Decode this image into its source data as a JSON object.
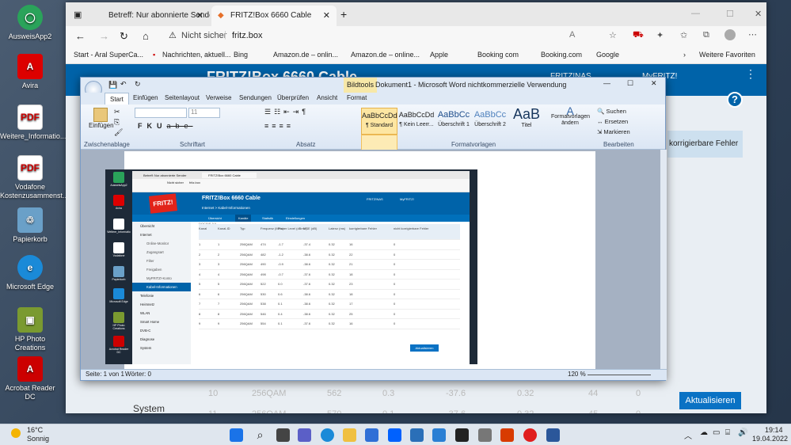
{
  "desktop": {
    "icons": [
      {
        "label": "AusweisApp2",
        "color": "#2aa35a"
      },
      {
        "label": "Avira",
        "color": "#d00"
      },
      {
        "label": "Weitere_Informatio...",
        "color": "#c00"
      },
      {
        "label": "Vodafone Kostenzusammenst...",
        "color": "#c00"
      },
      {
        "label": "Papierkorb",
        "color": "#6aa0c8"
      },
      {
        "label": "Microsoft Edge",
        "color": "#1a8ad8"
      },
      {
        "label": "HP Photo Creations",
        "color": "#7a9a30"
      },
      {
        "label": "Acrobat Reader DC",
        "color": "#c00"
      }
    ]
  },
  "browser": {
    "tabs": [
      {
        "title": "Betreff: Nur abonnierte Sender m"
      },
      {
        "title": "FRITZ!Box 6660 Cable"
      }
    ],
    "security": "Nicht sicher",
    "url": "fritz.box",
    "favorites": [
      "Start - Aral SuperCa...",
      "Nachrichten, aktuell...",
      "Bing",
      "Amazon.de – onlin...",
      "Amazon.de – online...",
      "Apple",
      "Booking com",
      "Booking.com",
      "Google"
    ],
    "more_favorites": "Weitere Favoriten",
    "page": {
      "title": "FRITZ!Box 6660 Cable",
      "nav1": "FRITZ!NAS",
      "nav2": "MyFRITZ!",
      "col_header": "korrigierbare Fehler",
      "sidebar_bottom": "System",
      "button": "Aktualisieren",
      "bg_rows": [
        [
          "10",
          "256QAM",
          "562",
          "0.3",
          "-37.6",
          "0.32",
          "44",
          "0"
        ],
        [
          "11",
          "256QAM",
          "570",
          "0.1",
          "-37.6",
          "0.32",
          "45",
          "0"
        ]
      ]
    }
  },
  "word": {
    "context_tab": "Bildtools",
    "title": "Dokument1 - Microsoft Word nichtkommerzielle Verwendung",
    "tabs": [
      "Start",
      "Einfügen",
      "Seitenlayout",
      "Verweise",
      "Sendungen",
      "Überprüfen",
      "Ansicht",
      "Format"
    ],
    "groups": [
      "Zwischenablage",
      "Schriftart",
      "Absatz",
      "Formatvorlagen",
      "Bearbeiten"
    ],
    "paste": "Einfügen",
    "font_size": "11",
    "styles": [
      {
        "preview": "AaBbCcDd",
        "name": "¶ Standard"
      },
      {
        "preview": "AaBbCcDd",
        "name": "¶ Kein Leerr..."
      },
      {
        "preview": "AaBbCc",
        "name": "Überschrift 1"
      },
      {
        "preview": "AaBbCc",
        "name": "Überschrift 2"
      },
      {
        "preview": "AaB",
        "name": "Titel"
      }
    ],
    "change_styles": "Formatvorlagen ändern",
    "edit": [
      "Suchen",
      "Ersetzen",
      "Markieren"
    ],
    "status": {
      "page": "Seite: 1 von 1",
      "words": "Wörter: 0",
      "zoom": "120 %"
    }
  },
  "inner": {
    "tabs": [
      "Betreff: Nur abonnierte Sender",
      "FRITZ!Box 6660 Cable"
    ],
    "security": "Nicht sicher",
    "url": "fritz.box",
    "title": "FRITZ!Box 6660 Cable",
    "breadcrumb": "Internet > Kabel-Informationen",
    "nav": [
      "FRITZ!NAS",
      "MyFRITZ!"
    ],
    "subtabs": [
      "Übersicht",
      "Kanäle",
      "Statistik",
      "Einstellungen"
    ],
    "docsis": "DOCSIS 3.0",
    "sidebar": [
      "Übersicht",
      "Internet",
      "Online-Monitor",
      "Zugangsart",
      "Filter",
      "Freigaben",
      "MyFRITZ!-Konto",
      "Kabel-Informationen",
      "Telefonie",
      "Heimnetz",
      "WLAN",
      "Smart Home",
      "DVB-C",
      "Diagnose",
      "System"
    ],
    "headers": [
      "Kanal",
      "Kanal-ID",
      "Typ",
      "Frequenz (MHz)",
      "Power Level (dBmV)",
      "MSE (dB)",
      "Latenz (ms)",
      "korrigierbare Fehler",
      "nicht korrigierbare Fehler"
    ],
    "rows": [
      [
        "1",
        "1",
        "256QAM",
        "474",
        "-1.7",
        "-37.4",
        "0.32",
        "16",
        "0"
      ],
      [
        "2",
        "2",
        "256QAM",
        "482",
        "-1.2",
        "-38.6",
        "0.32",
        "22",
        "0"
      ],
      [
        "3",
        "3",
        "256QAM",
        "490",
        "-0.9",
        "-38.6",
        "0.32",
        "21",
        "0"
      ],
      [
        "4",
        "4",
        "256QAM",
        "498",
        "-0.7",
        "-37.6",
        "0.32",
        "18",
        "0"
      ],
      [
        "5",
        "5",
        "256QAM",
        "522",
        "0.0",
        "-37.6",
        "0.32",
        "23",
        "0"
      ],
      [
        "6",
        "6",
        "256QAM",
        "530",
        "0.6",
        "-38.6",
        "0.32",
        "18",
        "0"
      ],
      [
        "7",
        "7",
        "256QAM",
        "538",
        "0.1",
        "-38.6",
        "0.32",
        "17",
        "0"
      ],
      [
        "8",
        "8",
        "256QAM",
        "546",
        "0.4",
        "-38.6",
        "0.32",
        "25",
        "0"
      ],
      [
        "9",
        "9",
        "256QAM",
        "554",
        "0.1",
        "-37.6",
        "0.32",
        "16",
        "0"
      ]
    ],
    "button": "Aktualisieren",
    "desktop": [
      "AusweisApp2",
      "Avira",
      "Weitere_Informatio",
      "Vodafone",
      "Papierkorb",
      "Microsoft Edge",
      "HP Photo Creations",
      "Acrobat Reader DC"
    ]
  },
  "taskbar": {
    "temp": "16°C",
    "weather": "Sonnig",
    "time": "19:14",
    "date": "19.04.2022"
  }
}
